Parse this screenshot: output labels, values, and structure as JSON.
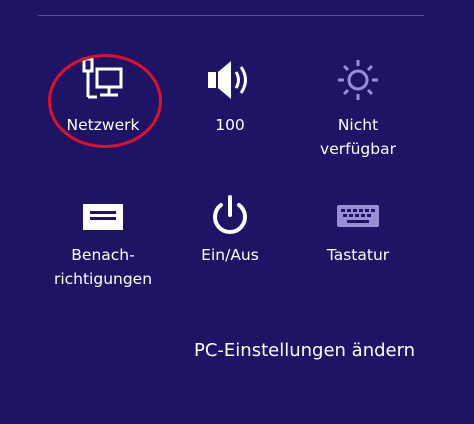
{
  "quick_settings": {
    "network": {
      "label": "Netzwerk",
      "icon": "network-icon"
    },
    "volume": {
      "label": "100",
      "icon": "speaker-icon"
    },
    "brightness": {
      "label_line1": "Nicht",
      "label_line2": "verfügbar",
      "icon": "brightness-icon"
    },
    "notifications": {
      "label_line1": "Benach-",
      "label_line2": "richtigungen",
      "icon": "notifications-icon"
    },
    "power": {
      "label": "Ein/Aus",
      "icon": "power-icon"
    },
    "keyboard": {
      "label": "Tastatur",
      "icon": "keyboard-icon"
    }
  },
  "footer": {
    "pc_settings_link": "PC-Einstellungen ändern"
  },
  "colors": {
    "background": "#1e1466",
    "highlight": "#e0102a",
    "disabled_icon": "#9a8fd6"
  }
}
